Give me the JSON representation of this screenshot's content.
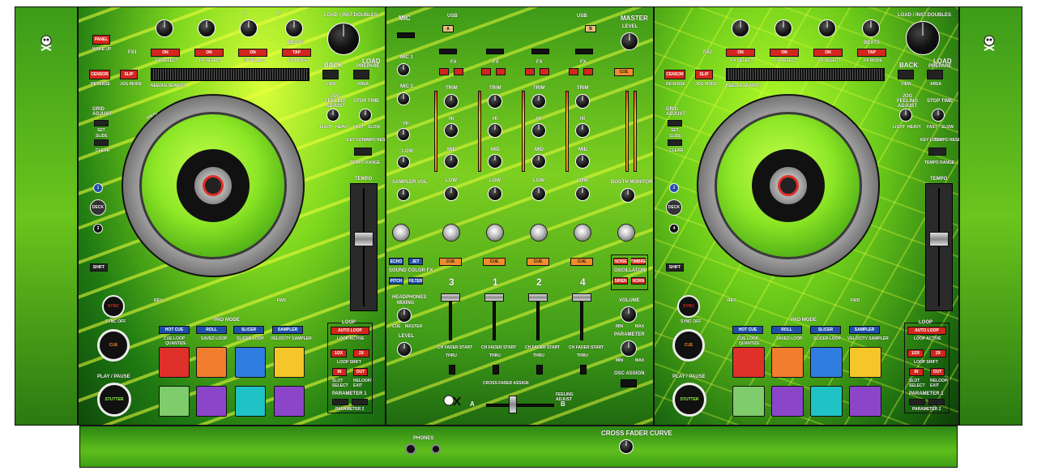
{
  "top": {
    "load_inst_doubles": "LOAD / INST.DOUBLES"
  },
  "deck_left": {
    "panel": "PANEL",
    "wake_up": "WAKE UP",
    "fx1": "FX1",
    "fx_select": "FX SELECT",
    "fx_mode": "FX MODE",
    "on": "ON",
    "tap": "TAP",
    "beats": "BEATS",
    "a": "A",
    "b": "B",
    "knob_nums": [
      "1",
      "2",
      "3"
    ],
    "back": "BACK",
    "load": "LOAD",
    "prepare": "PREPARE",
    "view": "VIEW",
    "area": "AREA",
    "reverse_btn": "CENSOR",
    "reverse": "REVERSE",
    "slip": "SLIP",
    "jog_mode": "JOG MODE",
    "needle_search": "NEEDLE SEARCH",
    "grid_adjust": "GRID ADJUST",
    "set": "SET",
    "slide": "SLIDE",
    "clear": "CLEAR",
    "jog_feeling": "JOG FEELING ADJUST",
    "stop_time": "STOP TIME",
    "light": "LIGHT",
    "heavy": "HEAVY",
    "fast": "FAST",
    "slow": "SLOW",
    "key_lock": "KEY LOCK",
    "tempo_reset": "TEMPO RESET",
    "tempo_range": "TEMPO RANGE",
    "tempo": "TEMPO",
    "vinyl": "VINYL",
    "rev": "REV",
    "fwd": "FWD",
    "deck": "DECK",
    "deck_a": "1",
    "deck_b": "3",
    "shift": "SHIFT",
    "sync": "SYNC",
    "sync_off": "SYNC OFF",
    "cue": "CUE",
    "play_pause": "PLAY / PAUSE",
    "stutter": "STUTTER",
    "pad_mode": "PAD MODE",
    "hot_cue": "HOT CUE",
    "roll": "ROLL",
    "slicer": "SLICER",
    "sampler": "SAMPLER",
    "cue_loop": "CUE LOOP",
    "saved_loop": "SAVED LOOP",
    "slicer_loop": "SLICER LOOP",
    "velocity_sampler": "VELOCITY SAMPLER",
    "quantize": "QUANTIZE",
    "loop": "LOOP",
    "auto_loop": "AUTO LOOP",
    "loop_active": "LOOP ACTIVE",
    "half": "1/2X",
    "double": "2X",
    "loop_shift": "LOOP SHIFT",
    "in": "IN",
    "out": "OUT",
    "slot_select": "SLOT SELECT",
    "reloop_exit": "RELOOP/ EXIT",
    "parameter1": "PARAMETER 1",
    "parameter2": "PARAMETER 2",
    "pad_colors": [
      "#e0302a",
      "#f07e2e",
      "#2f7de0",
      "#f4c62a",
      "#7fcc6c",
      "#8a45c9",
      "#1fc3c6",
      "#8a45c9"
    ]
  },
  "deck_right": {
    "fx2": "FX2",
    "deck_a": "2",
    "deck_b": "4",
    "pad_colors": [
      "#e0302a",
      "#f07e2e",
      "#2f7de0",
      "#f4c62a",
      "#7fcc6c",
      "#8a45c9",
      "#1fc3c6",
      "#8a45c9"
    ]
  },
  "mixer": {
    "mic": "MIC",
    "usb": "USB",
    "master": "MASTER",
    "level": "LEVEL",
    "mic1": "MIC 1",
    "mic2": "MIC 2",
    "hi": "HI",
    "low": "LOW",
    "sampler_vol": "SAMPLER VOL",
    "fx": "FX",
    "trim": "TRIM",
    "mid": "MID",
    "filter": "FILTER",
    "cue": "CUE",
    "booth_monitor": "BOOTH MONITOR",
    "sound_color_fx": "SOUND COLOR FX",
    "echo": "ECHO",
    "jet": "JET",
    "pitch": "PITCH",
    "filter_btn": "FILTER",
    "oscillator": "OSCILLATOR",
    "noise": "NOISE",
    "timbre": "TIMBRE",
    "siren": "SIREN",
    "horn": "HORN",
    "headphones": "HEADPHONES",
    "mixing": "MIXING",
    "cue_label": "CUE",
    "master_label": "MASTER",
    "volume": "VOLUME",
    "min": "MIN",
    "max": "MAX",
    "parameter": "PARAMETER",
    "osc_assign": "OSC ASSIGN",
    "channels": [
      "3",
      "1",
      "2",
      "4"
    ],
    "ch_fader_start": "CH FADER START",
    "thru": "THRU",
    "cross_fader_assign": "CROSS FADER ASSIGN",
    "feeling_adjust": "FEELING ADJUST",
    "cf_a": "A",
    "cf_b": "B"
  },
  "bottom": {
    "phones": "PHONES",
    "cross_fader_curve": "CROSS FADER CURVE"
  }
}
